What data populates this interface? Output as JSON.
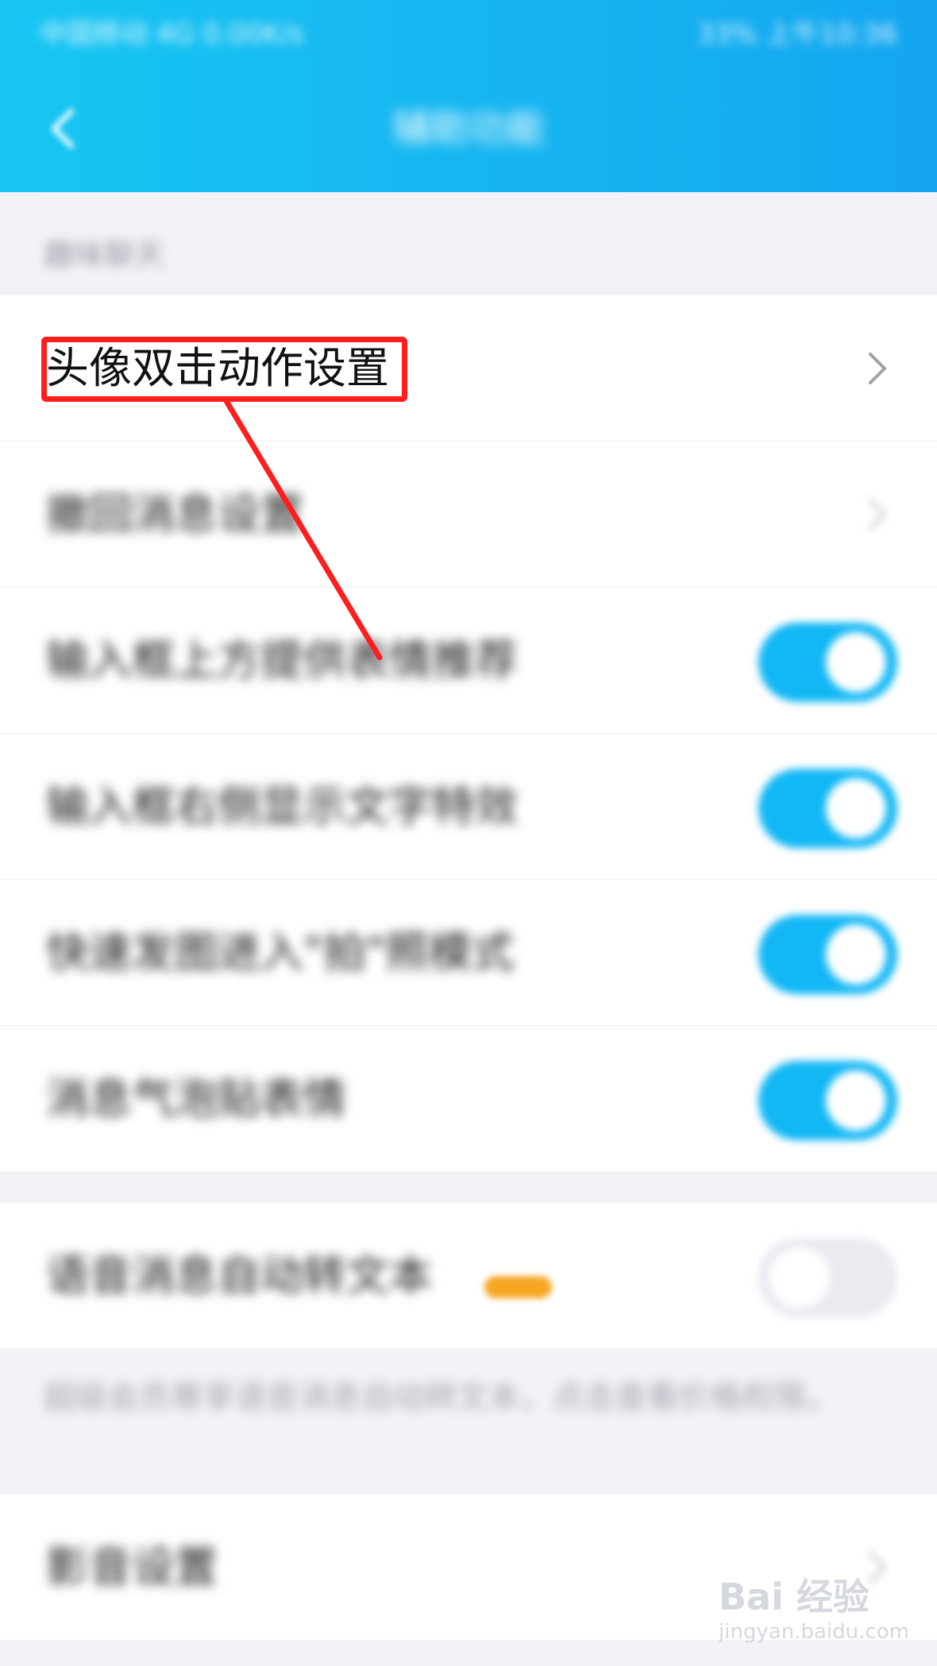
{
  "header": {
    "status_left": "中国移动 4G 0.00K/s",
    "status_right": "33% 上午10:36",
    "title": "辅助功能"
  },
  "section_label": "趣味聊天",
  "rows": [
    {
      "label": "头像双击动作设置",
      "control": "chevron"
    },
    {
      "label": "撤回消息设置",
      "control": "chevron"
    },
    {
      "label": "输入框上方提供表情推荐",
      "control": "toggle",
      "on": true
    },
    {
      "label": "输入框右侧显示文字特效",
      "control": "toggle",
      "on": true
    },
    {
      "label": "快速发图进入\"拍\"照模式",
      "control": "toggle",
      "on": true
    },
    {
      "label": "消息气泡贴表情",
      "control": "toggle",
      "on": true
    },
    {
      "label": "语音消息自动转文本",
      "control": "toggle",
      "on": false,
      "badge_color": "#f6a623"
    },
    {
      "label": "影音设置",
      "control": "chevron"
    }
  ],
  "footnote": "超级会员尊享语音消息自动转文本，点击查看价格权限。",
  "annotation": {
    "color": "#ff1d1d"
  },
  "watermark": {
    "brand": "Bai 经验",
    "url": "jingyan.baidu.com"
  },
  "colors": {
    "accent": "#12b7f5",
    "header_start": "#18c6f2",
    "header_end": "#14a6f0"
  }
}
